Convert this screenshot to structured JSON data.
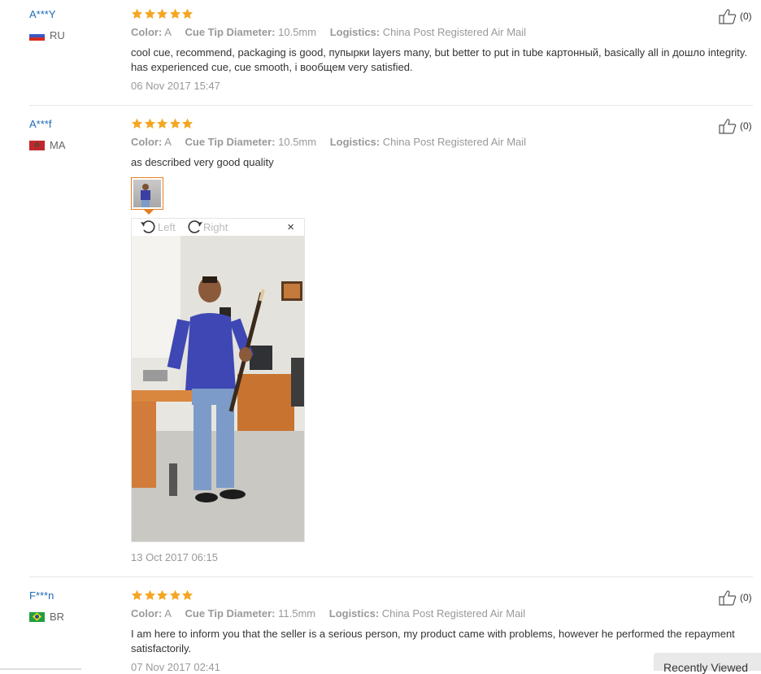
{
  "reviews": [
    {
      "user": "A***Y",
      "country": "RU",
      "rating": 5,
      "attributes": [
        {
          "key": "Color:",
          "value": "A"
        },
        {
          "key": "Cue Tip Diameter:",
          "value": "10.5mm"
        },
        {
          "key": "Logistics:",
          "value": "China Post Registered Air Mail"
        }
      ],
      "text": "cool cue, recommend, packaging is good, пупырки layers many, but better to put in tube картонный, basically all in дошло integrity. has experienced cue, cue smooth, i вообщем very satisfied.",
      "date": "06 Nov 2017 15:47",
      "likes": "(0)"
    },
    {
      "user": "A***f",
      "country": "MA",
      "rating": 5,
      "attributes": [
        {
          "key": "Color:",
          "value": "A"
        },
        {
          "key": "Cue Tip Diameter:",
          "value": "10.5mm"
        },
        {
          "key": "Logistics:",
          "value": "China Post Registered Air Mail"
        }
      ],
      "text": "as described very good quality",
      "date": "13 Oct 2017 06:15",
      "likes": "(0)",
      "viewer": {
        "left_label": "Left",
        "right_label": "Right",
        "close": "×"
      }
    },
    {
      "user": "F***n",
      "country": "BR",
      "rating": 5,
      "attributes": [
        {
          "key": "Color:",
          "value": "A"
        },
        {
          "key": "Cue Tip Diameter:",
          "value": "11.5mm"
        },
        {
          "key": "Logistics:",
          "value": "China Post Registered Air Mail"
        }
      ],
      "text": "I am here to inform you that the seller is a serious person, my product came with problems, however he performed the repayment satisfactorily.",
      "date": "07 Nov 2017 02:41",
      "likes": "(0)"
    }
  ],
  "recently_viewed": "Recently Viewed",
  "colors": {
    "star": "#f5a623",
    "username": "#1e6bb8",
    "thumb_border": "#e67e22"
  }
}
